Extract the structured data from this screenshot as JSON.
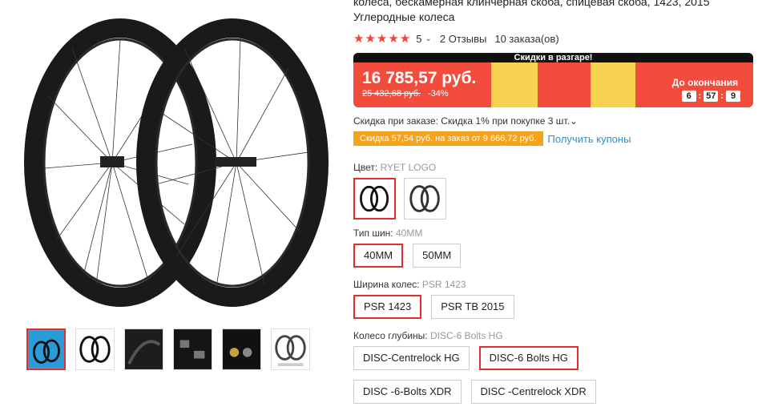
{
  "product": {
    "title": "колеса, бескамерная клинчерная скоба, спицевая скоба, 1423, 2015 Углеродные колеса",
    "stars": "★★★★★",
    "rating": "5",
    "reviews": "2 Отзывы",
    "orders": "10 заказа(ов)"
  },
  "promo": {
    "banner": "Скидки в разгаре!",
    "price": "16 785,57 руб.",
    "old_price": "25 432,68 руб.",
    "discount": "-34%",
    "countdown_label": "До окончания",
    "hours": "6",
    "minutes": "57",
    "seconds": "9",
    "colors": {
      "bg": "#f24c3d",
      "puzzle": "#f7d250"
    }
  },
  "discounts": {
    "order_discount": "Скидка при заказе: Скидка 1% при покупке 3 шт.",
    "coupon_badge": "Скидка 57,54 руб. на заказ от 9 666,72 руб.",
    "coupon_link": "Получить купоны"
  },
  "options": {
    "color_label": "Цвет:",
    "color_value": "RYET LOGO",
    "tire_label": "Тип шин:",
    "tire_value": "40MM",
    "tire_options": [
      "40MM",
      "50MM"
    ],
    "width_label": "Ширина колес:",
    "width_value": "PSR 1423",
    "width_options": [
      "PSR 1423",
      "PSR TB 2015"
    ],
    "depth_label": "Колесо глубины:",
    "depth_value": "DISC-6 Bolts HG",
    "depth_options": [
      "DISC-Centrelock HG",
      "DISC-6 Bolts HG",
      "DISC -6-Bolts XDR",
      "DISC -Centrelock XDR"
    ]
  },
  "icons": {
    "rating_chevron": "chevron-down-icon",
    "discount_chevron": "chevron-down-icon"
  }
}
